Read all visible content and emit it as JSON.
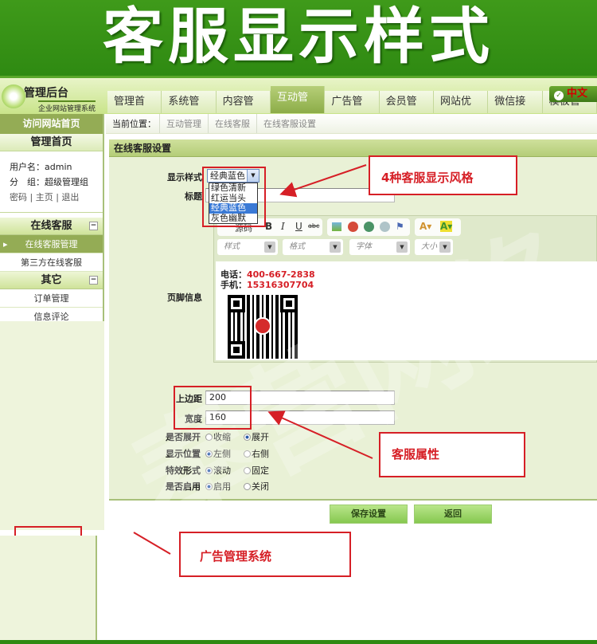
{
  "banner": {
    "title": "客服显示样式"
  },
  "header": {
    "logo_title": "管理后台",
    "logo_subtitle": "企业网站管理系统",
    "lang": "中文",
    "nav": [
      "管理首页",
      "系统管理",
      "内容管理",
      "互动管理",
      "广告管理",
      "会员管理",
      "网站优化",
      "微信接口",
      "模板管理"
    ],
    "active_nav": "互动管理"
  },
  "sidebar": {
    "visit_site": "访问网站首页",
    "home": "管理首页",
    "username_label": "用户名：",
    "username": "admin",
    "group_label": "分　组：",
    "group": "超级管理组",
    "links": [
      "密码",
      "主页",
      "退出"
    ],
    "sections": [
      {
        "title": "在线客服",
        "items": [
          "在线客服管理",
          "第三方在线客服"
        ],
        "active": "在线客服管理"
      },
      {
        "title": "其它",
        "items": [
          "订单管理",
          "信息评论"
        ]
      }
    ]
  },
  "breadcrumb": {
    "label": "当前位置：",
    "items": [
      "互动管理",
      "在线客服",
      "在线客服设置"
    ]
  },
  "panel": {
    "title": "在线客服设置",
    "style_label": "显示样式",
    "style_value": "经典蓝色",
    "style_options": [
      "绿色清新",
      "红运当头",
      "经典蓝色",
      "灰色幽默"
    ],
    "title_label": "标题",
    "footer_label": "页脚信息",
    "editor": {
      "source": "源码",
      "formats": [
        "样式",
        "格式",
        "字体",
        "大小"
      ],
      "phone_label": "电话：",
      "phone": "400-667-2838",
      "mobile_label": "手机：",
      "mobile": "15316307704"
    },
    "top_margin_label": "上边距",
    "top_margin": "200",
    "width_label": "宽度",
    "width": "160",
    "radios": [
      {
        "label": "是否展开",
        "options": [
          "收缩",
          "展开"
        ],
        "selected": "展开"
      },
      {
        "label": "显示位置",
        "options": [
          "左侧",
          "右侧"
        ],
        "selected": "左侧"
      },
      {
        "label": "特效形式",
        "options": [
          "滚动",
          "固定"
        ],
        "selected": "滚动"
      },
      {
        "label": "是否启用",
        "options": [
          "启用",
          "关闭"
        ],
        "selected": "启用"
      }
    ],
    "save": "保存设置",
    "back": "返回"
  },
  "annotations": {
    "styles": "4种客服显示风格",
    "props": "客服属性",
    "ads": "广告管理系统"
  },
  "watermark": "奉营网络",
  "colors": {
    "brand_green": "#2f8a12",
    "accent_olive": "#94ac55",
    "annotation_red": "#d61f26",
    "panel_bg": "#e9f1d6"
  }
}
